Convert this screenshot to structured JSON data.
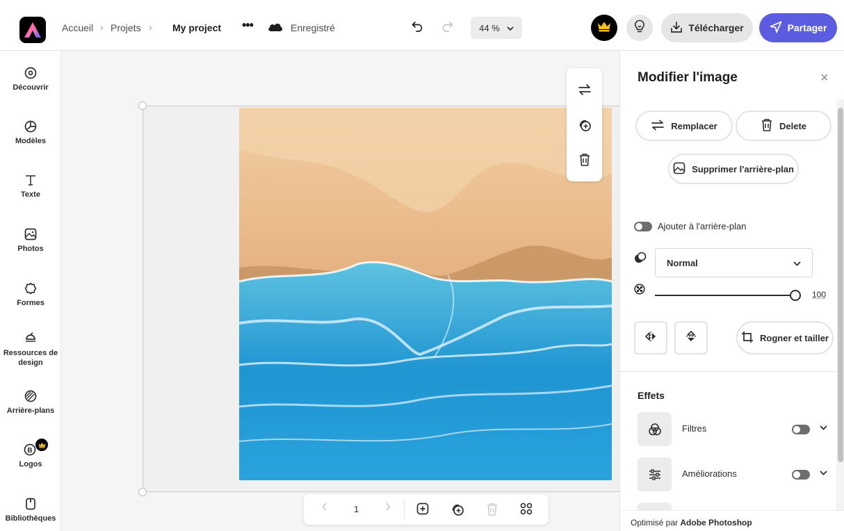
{
  "header": {
    "breadcrumbs": [
      "Accueil",
      "Projets"
    ],
    "project_title": "My project",
    "more_label": "•••",
    "save_status": "Enregistré",
    "zoom": "44 %",
    "download_label": "Télécharger",
    "share_label": "Partager"
  },
  "leftnav": {
    "items": [
      {
        "label": "Découvrir",
        "icon": "compass-icon"
      },
      {
        "label": "Modèles",
        "icon": "templates-icon"
      },
      {
        "label": "Texte",
        "icon": "text-icon"
      },
      {
        "label": "Photos",
        "icon": "photo-icon"
      },
      {
        "label": "Formes",
        "icon": "shapes-icon"
      },
      {
        "label": "Ressources de design",
        "icon": "design-assets-icon"
      },
      {
        "label": "Arrière-plans",
        "icon": "backgrounds-icon"
      },
      {
        "label": "Logos",
        "icon": "logo-icon"
      },
      {
        "label": "Bibliothèques",
        "icon": "libraries-icon"
      }
    ]
  },
  "pager": {
    "page_number": "1"
  },
  "panel": {
    "title": "Modifier l'image",
    "close_glyph": "×",
    "replace_label": "Remplacer",
    "delete_label": "Delete",
    "remove_bg_label": "Supprimer l'arrière-plan",
    "add_to_bg_label": "Ajouter à l'arrière-plan",
    "blend_mode": "Normal",
    "opacity_value": "100",
    "opacity_fraction": 1.0,
    "crop_label": "Rogner et tailler",
    "effects_title": "Effets",
    "effects": [
      {
        "label": "Filtres",
        "enabled": false
      },
      {
        "label": "Améliorations",
        "enabled": false
      }
    ],
    "footer_prefix": "Optimisé par",
    "footer_brand": "Adobe Photoshop"
  },
  "colors": {
    "accent": "#5c5ce0",
    "sand": "#e8b98a",
    "sea": "#2e9fd8"
  }
}
